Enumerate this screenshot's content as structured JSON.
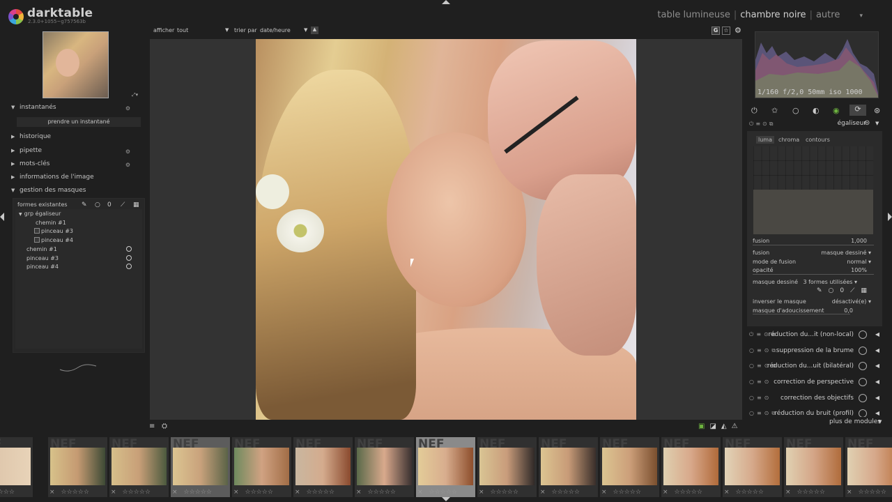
{
  "app": {
    "name": "darktable",
    "version": "2.3.0+1055~g757563b"
  },
  "views": {
    "lighttable": "table lumineuse",
    "darkroom": "chambre noire",
    "other": "autre",
    "sep": "|"
  },
  "topbar": {
    "dropdown_icon": "▾"
  },
  "filter": {
    "show_label": "afficher",
    "show_value": "tout",
    "sort_label": "trier par",
    "sort_value": "date/heure"
  },
  "histogram": {
    "info": "1/160 f/2,0 50mm iso 1000"
  },
  "left_panel": {
    "sections": [
      {
        "label": "instantanés",
        "expanded": true
      },
      {
        "label": "historique",
        "expanded": false
      },
      {
        "label": "pipette",
        "expanded": false
      },
      {
        "label": "mots-clés",
        "expanded": false
      },
      {
        "label": "informations de l'image",
        "expanded": false
      },
      {
        "label": "gestion des masques",
        "expanded": true
      }
    ],
    "snapshot_button": "prendre un instantané",
    "masks_header": "formes existantes",
    "mask_tree": [
      {
        "label": "grp égaliseur",
        "level": 0,
        "type": "group"
      },
      {
        "label": "chemin #1",
        "level": 1,
        "type": "shape"
      },
      {
        "label": "pinceau #3",
        "level": 1,
        "type": "shape"
      },
      {
        "label": "pinceau #4",
        "level": 1,
        "type": "shape"
      },
      {
        "label": "chemin #1",
        "level": 0,
        "type": "shape"
      },
      {
        "label": "pinceau #3",
        "level": 0,
        "type": "shape"
      },
      {
        "label": "pinceau #4",
        "level": 0,
        "type": "shape"
      }
    ]
  },
  "right_panel": {
    "module_title": "égaliseur",
    "tabs": [
      "luma",
      "chroma",
      "contours"
    ],
    "active_tab": "luma",
    "params": {
      "blend_label": "fusion",
      "blend_value": "1,000",
      "fusion_label": "fusion",
      "fusion_value": "masque dessiné",
      "mode_label": "mode de fusion",
      "mode_value": "normal",
      "opacity_label": "opacité",
      "opacity_value": "100%",
      "mask_label": "masque dessiné",
      "mask_value": "3 formes utilisées",
      "invert_label": "inverser le masque",
      "invert_value": "désactivé(e)",
      "soften_label": "masque d'adoucissement",
      "soften_value": "0,0"
    },
    "modules": [
      "réduction du...it (non-local)",
      "suppression de la brume",
      "réduction du...uit (bilatéral)",
      "correction de perspective",
      "correction des objectifs",
      "réduction du bruit (profil)"
    ],
    "more_modules": "plus de modules"
  },
  "filmstrip": {
    "stars": "☆☆☆☆☆",
    "reject": "×",
    "watermark": "NEF",
    "selected_index": 3,
    "current_index": 7
  },
  "colors": {
    "background": "#1f1f1f",
    "panel": "#2b2b2b",
    "center": "#333333",
    "text": "#b5b5b5"
  }
}
